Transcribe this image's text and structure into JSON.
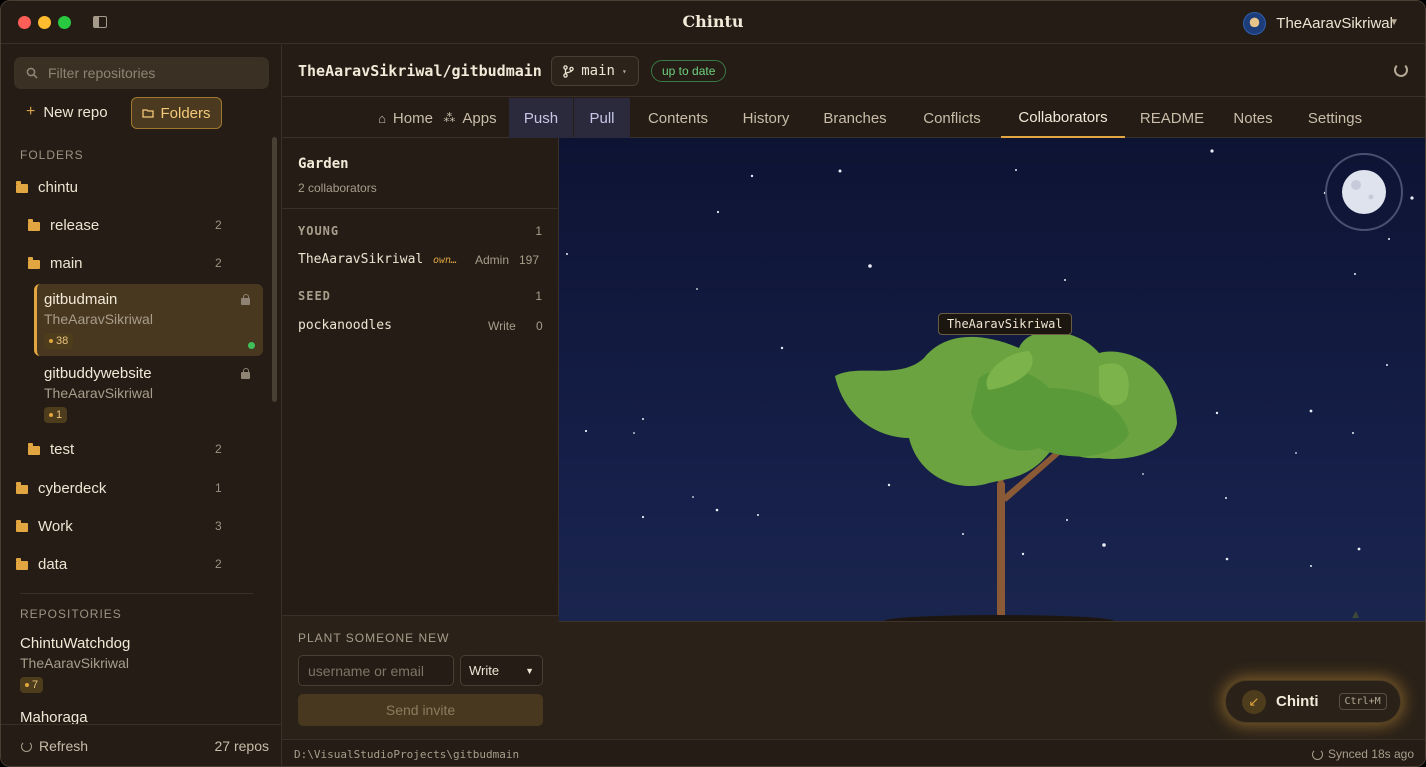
{
  "app": {
    "title": "Chintu",
    "user": "TheAaravSikriwal"
  },
  "sidebar": {
    "filter_placeholder": "Filter repositories",
    "new_repo": "New repo",
    "folders_button": "Folders",
    "folders_label": "FOLDERS",
    "folders": [
      {
        "name": "chintu"
      },
      {
        "name": "release",
        "count": "2"
      },
      {
        "name": "main",
        "count": "2"
      },
      {
        "name": "test",
        "count": "2"
      },
      {
        "name": "cyberdeck",
        "count": "1"
      },
      {
        "name": "Work",
        "count": "3"
      },
      {
        "name": "data",
        "count": "2"
      }
    ],
    "folder_repos": [
      {
        "name": "gitbudmain",
        "owner": "TheAaravSikriwal",
        "badge": "38"
      },
      {
        "name": "gitbuddywebsite",
        "owner": "TheAaravSikriwal",
        "badge": "1"
      }
    ],
    "repositories_label": "REPOSITORIES",
    "repositories": [
      {
        "name": "ChintuWatchdog",
        "owner": "TheAaravSikriwal",
        "badge": "7"
      },
      {
        "name": "Mahoraga"
      }
    ],
    "refresh": "Refresh",
    "repo_count": "27 repos"
  },
  "repo": {
    "path": "TheAaravSikriwal/gitbudmain",
    "branch": "main",
    "status": "up to date"
  },
  "tabs": [
    "Home",
    "Apps",
    "Push",
    "Pull",
    "Contents",
    "History",
    "Branches",
    "Conflicts",
    "Collaborators",
    "README",
    "Notes",
    "Settings"
  ],
  "active_tab": "Collaborators",
  "garden": {
    "title": "Garden",
    "subtitle": "2 collaborators",
    "groups": [
      {
        "name": "YOUNG",
        "count": "1",
        "members": [
          {
            "name": "TheAaravSikriwal",
            "tag": "own…",
            "role": "Admin",
            "value": "197"
          }
        ]
      },
      {
        "name": "SEED",
        "count": "1",
        "members": [
          {
            "name": "pockanoodles",
            "role": "Write",
            "value": "0"
          }
        ]
      }
    ],
    "plant_label": "PLANT SOMEONE NEW",
    "invite_placeholder": "username or email",
    "permission": "Write",
    "send": "Send invite"
  },
  "scene": {
    "tree_label": "TheAaravSikriwal"
  },
  "assistant": {
    "name": "Chinti",
    "shortcut": "Ctrl+M"
  },
  "statusbar": {
    "path": "D:\\VisualStudioProjects\\gitbudmain",
    "synced": "Synced 18s ago"
  },
  "colors": {
    "accent": "#e2a640",
    "background": "#241c15",
    "sky": "#16204a",
    "ok": "#6fd07f"
  }
}
